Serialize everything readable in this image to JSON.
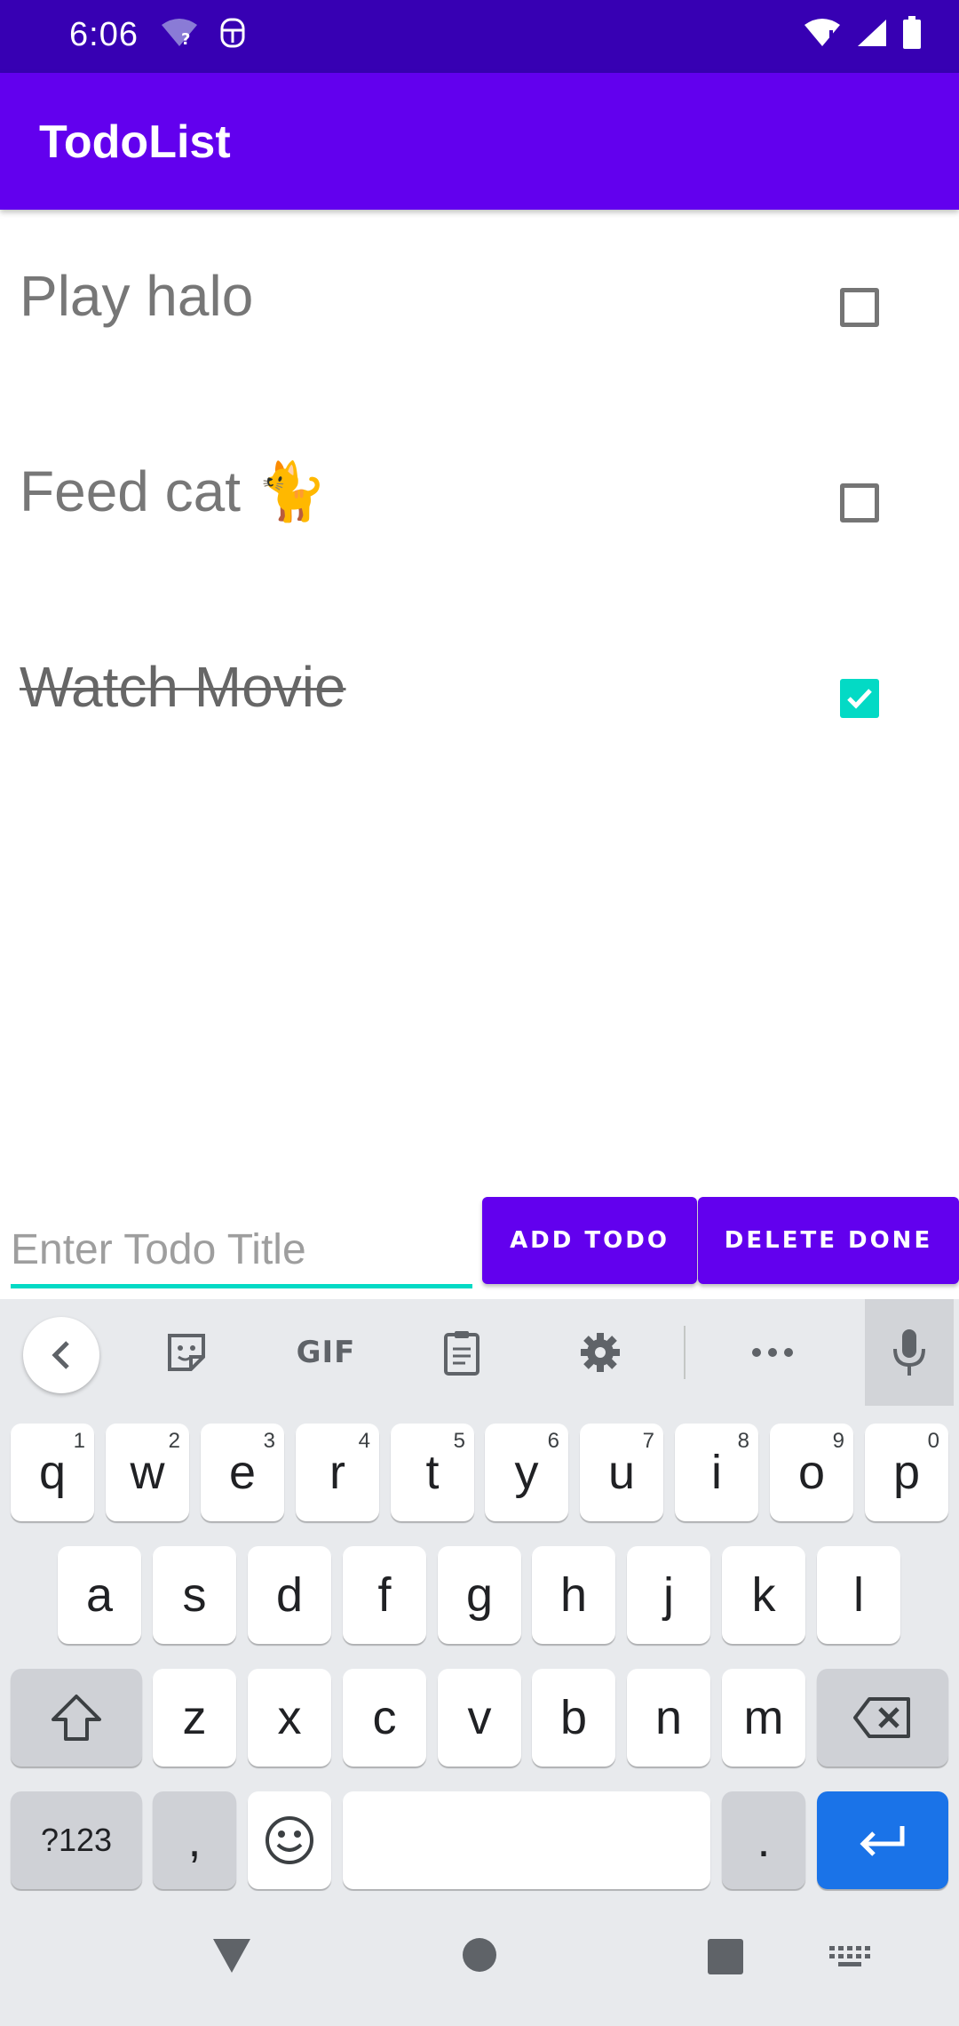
{
  "status_bar": {
    "time": "6:06"
  },
  "app_bar": {
    "title": "TodoList"
  },
  "todos": [
    {
      "label": "Play halo",
      "checked": false
    },
    {
      "label": "Feed cat 🐈",
      "checked": false
    },
    {
      "label": "Watch Movie",
      "checked": true
    }
  ],
  "input": {
    "placeholder": "Enter Todo Title",
    "value": ""
  },
  "buttons": {
    "add_label": "ADD TODO",
    "delete_label": "DELETE DONE"
  },
  "keyboard": {
    "toolbar": {
      "gif_label": "GIF"
    },
    "row1": [
      {
        "key": "q",
        "hint": "1"
      },
      {
        "key": "w",
        "hint": "2"
      },
      {
        "key": "e",
        "hint": "3"
      },
      {
        "key": "r",
        "hint": "4"
      },
      {
        "key": "t",
        "hint": "5"
      },
      {
        "key": "y",
        "hint": "6"
      },
      {
        "key": "u",
        "hint": "7"
      },
      {
        "key": "i",
        "hint": "8"
      },
      {
        "key": "o",
        "hint": "9"
      },
      {
        "key": "p",
        "hint": "0"
      }
    ],
    "row2": [
      "a",
      "s",
      "d",
      "f",
      "g",
      "h",
      "j",
      "k",
      "l"
    ],
    "row3": [
      "z",
      "x",
      "c",
      "v",
      "b",
      "n",
      "m"
    ],
    "symbols_label": "?123",
    "comma_label": ",",
    "period_label": "."
  },
  "colors": {
    "status_bar": "#3700b3",
    "app_bar": "#6200ee",
    "accent": "#03dac5",
    "enter_key": "#1a73e8"
  }
}
